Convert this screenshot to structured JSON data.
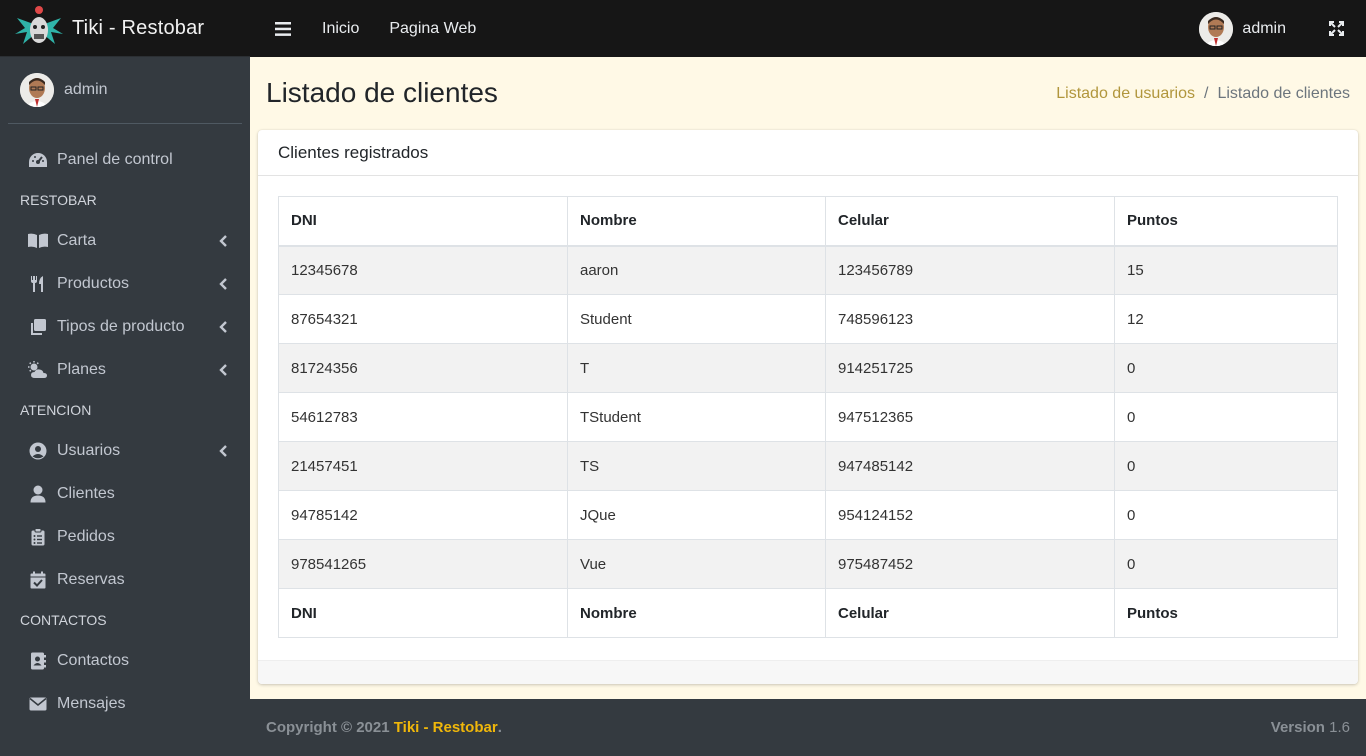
{
  "brand": {
    "name": "Tiki - Restobar"
  },
  "navbar": {
    "toggle_icon": "bars-icon",
    "links": [
      "Inicio",
      "Pagina Web"
    ],
    "user": "admin",
    "fullscreen_icon": "expand-icon"
  },
  "sidebar": {
    "user": "admin",
    "items": [
      {
        "type": "item",
        "label": "Panel de control",
        "icon": "tachometer-icon",
        "chevron": false
      },
      {
        "type": "header",
        "label": "RESTOBAR"
      },
      {
        "type": "item",
        "label": "Carta",
        "icon": "book-icon",
        "chevron": true
      },
      {
        "type": "item",
        "label": "Productos",
        "icon": "utensils-icon",
        "chevron": true
      },
      {
        "type": "item",
        "label": "Tipos de producto",
        "icon": "copy-icon",
        "chevron": true
      },
      {
        "type": "item",
        "label": "Planes",
        "icon": "cloud-sun-icon",
        "chevron": true
      },
      {
        "type": "header",
        "label": "ATENCION"
      },
      {
        "type": "item",
        "label": "Usuarios",
        "icon": "user-circle-icon",
        "chevron": true
      },
      {
        "type": "item",
        "label": "Clientes",
        "icon": "user-icon",
        "chevron": false
      },
      {
        "type": "item",
        "label": "Pedidos",
        "icon": "clipboard-list-icon",
        "chevron": false
      },
      {
        "type": "item",
        "label": "Reservas",
        "icon": "calendar-check-icon",
        "chevron": false
      },
      {
        "type": "header",
        "label": "CONTACTOS"
      },
      {
        "type": "item",
        "label": "Contactos",
        "icon": "address-book-icon",
        "chevron": false
      },
      {
        "type": "item",
        "label": "Mensajes",
        "icon": "envelope-icon",
        "chevron": false
      }
    ]
  },
  "content": {
    "title": "Listado de clientes",
    "breadcrumb": {
      "link": "Listado de usuarios",
      "separator": "/",
      "active": "Listado de clientes"
    },
    "card_title": "Clientes registrados",
    "table": {
      "columns": [
        "DNI",
        "Nombre",
        "Celular",
        "Puntos"
      ],
      "rows": [
        [
          "12345678",
          "aaron",
          "123456789",
          "15"
        ],
        [
          "87654321",
          "Student",
          "748596123",
          "12"
        ],
        [
          "81724356",
          "T",
          "914251725",
          "0"
        ],
        [
          "54612783",
          "TStudent",
          "947512365",
          "0"
        ],
        [
          "21457451",
          "TS",
          "947485142",
          "0"
        ],
        [
          "94785142",
          "JQue",
          "954124152",
          "0"
        ],
        [
          "978541265",
          "Vue",
          "975487452",
          "0"
        ]
      ]
    }
  },
  "footer": {
    "copyright": "Copyright © 2021",
    "brand": "Tiki - Restobar",
    "period": ".",
    "version_label": "Version",
    "version": "1.6"
  },
  "colors": {
    "sidebar_bg": "#343a40",
    "navbar_bg": "#161616",
    "content_bg": "#fff9e6",
    "breadcrumb_link": "#b1963c",
    "footer_brand": "#f0b70a"
  }
}
